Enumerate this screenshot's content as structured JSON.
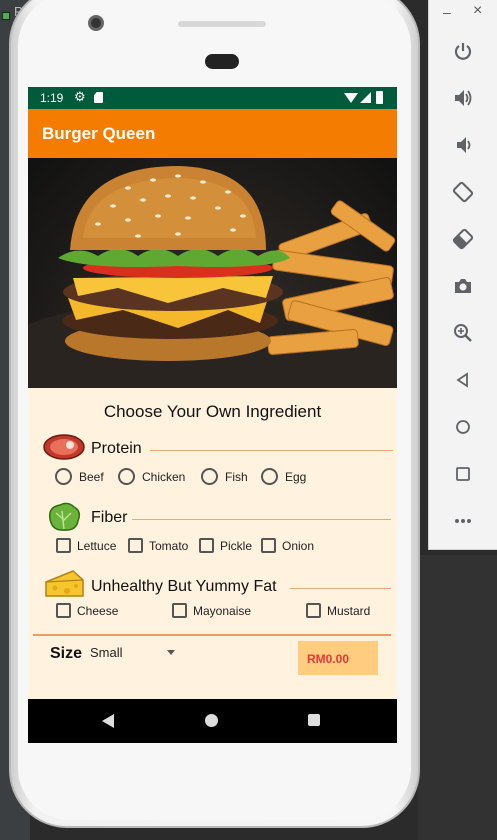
{
  "ide": {
    "tab_label": "P"
  },
  "statusbar": {
    "time": "1:19"
  },
  "appbar": {
    "title": "Burger Queen"
  },
  "main": {
    "title": "Choose Your Own Ingredient"
  },
  "protein": {
    "label": "Protein",
    "options": [
      "Beef",
      "Chicken",
      "Fish",
      "Egg"
    ]
  },
  "fiber": {
    "label": "Fiber",
    "options": [
      "Lettuce",
      "Tomato",
      "Pickle",
      "Onion"
    ]
  },
  "fat": {
    "label": "Unhealthy But Yummy Fat",
    "options": [
      "Cheese",
      "Mayonaise",
      "Mustard"
    ]
  },
  "size": {
    "label": "Size",
    "selected": "Small"
  },
  "price": "RM0.00",
  "emulator": {
    "window_controls": {
      "minimize": "–",
      "close": "×"
    },
    "buttons": [
      "power",
      "volume-up",
      "volume-down",
      "rotate-left",
      "rotate-right",
      "screenshot",
      "zoom",
      "back",
      "home",
      "overview",
      "more"
    ]
  },
  "colors": {
    "appbar": "#f47c00",
    "statusbar": "#005a3c",
    "background": "#fff3e0",
    "price_bg": "#ffcc80",
    "price_text": "#e53935",
    "divider": "#f0996a"
  }
}
